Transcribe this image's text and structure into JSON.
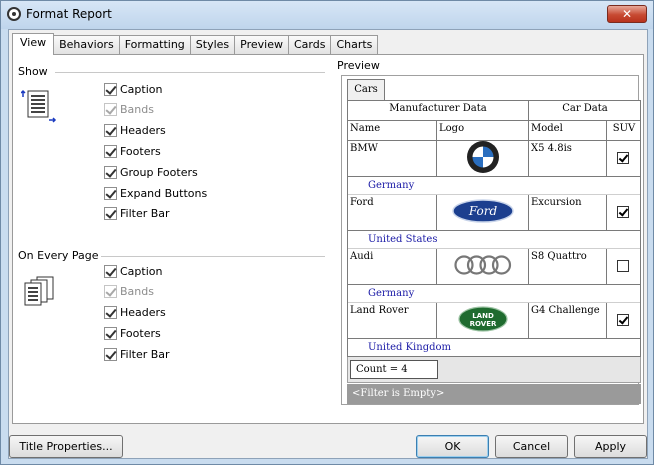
{
  "window": {
    "title": "Format Report",
    "close_glyph": "✕"
  },
  "tabs": [
    {
      "label": "View",
      "active": true
    },
    {
      "label": "Behaviors"
    },
    {
      "label": "Formatting"
    },
    {
      "label": "Styles"
    },
    {
      "label": "Preview"
    },
    {
      "label": "Cards"
    },
    {
      "label": "Charts"
    }
  ],
  "show": {
    "label": "Show",
    "options": [
      {
        "label": "Caption",
        "checked": true,
        "enabled": true
      },
      {
        "label": "Bands",
        "checked": true,
        "enabled": false
      },
      {
        "label": "Headers",
        "checked": true,
        "enabled": true
      },
      {
        "label": "Footers",
        "checked": true,
        "enabled": true
      },
      {
        "label": "Group Footers",
        "checked": true,
        "enabled": true
      },
      {
        "label": "Expand Buttons",
        "checked": true,
        "enabled": true
      },
      {
        "label": "Filter Bar",
        "checked": true,
        "enabled": true
      }
    ]
  },
  "every_page": {
    "label": "On Every Page",
    "options": [
      {
        "label": "Caption",
        "checked": true,
        "enabled": true
      },
      {
        "label": "Bands",
        "checked": true,
        "enabled": false
      },
      {
        "label": "Headers",
        "checked": true,
        "enabled": true
      },
      {
        "label": "Footers",
        "checked": true,
        "enabled": true
      },
      {
        "label": "Filter Bar",
        "checked": true,
        "enabled": true
      }
    ]
  },
  "preview": {
    "label": "Preview",
    "tab": "Cars",
    "bands": [
      "Manufacturer Data",
      "Car Data"
    ],
    "columns": [
      "Name",
      "Logo",
      "Model",
      "SUV"
    ],
    "rows": [
      {
        "name": "BMW",
        "logo": "bmw-logo",
        "model": "X5 4.8is",
        "suv": true,
        "group": "Germany"
      },
      {
        "name": "Ford",
        "logo": "ford-logo",
        "model": "Excursion",
        "suv": true,
        "group": "United States"
      },
      {
        "name": "Audi",
        "logo": "audi-logo",
        "model": "S8 Quattro",
        "suv": false,
        "group": "Germany"
      },
      {
        "name": "Land Rover",
        "logo": "land-rover-logo",
        "model": "G4 Challenge",
        "suv": true,
        "group": "United Kingdom"
      }
    ],
    "logo_text": {
      "ford": "Ford",
      "land_rover_top": "LAND",
      "land_rover_bottom": "ROVER"
    },
    "count": "Count = 4",
    "filter": "<Filter is Empty>"
  },
  "buttons": {
    "title_properties": "Title Properties...",
    "ok": "OK",
    "cancel": "Cancel",
    "apply": "Apply"
  },
  "colors": {
    "group_text": "#1a1aa6",
    "filter_bar": "#9a9a9a"
  }
}
